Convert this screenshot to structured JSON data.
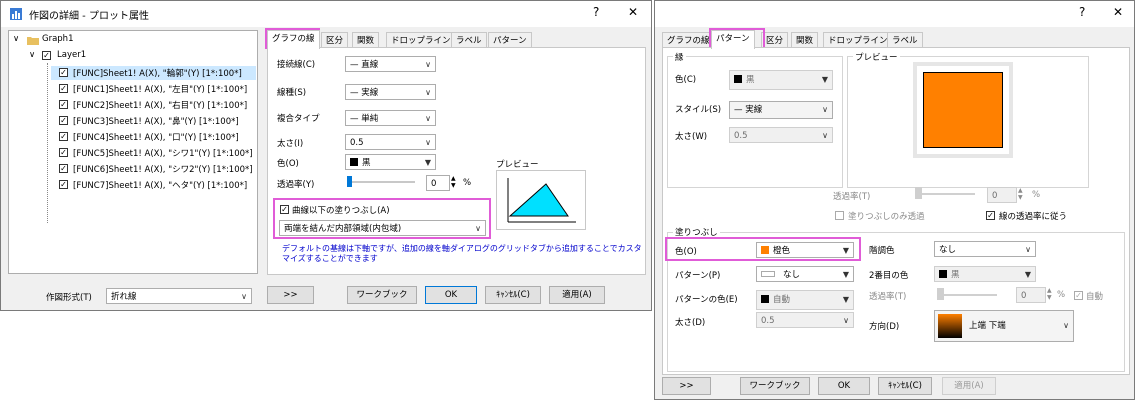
{
  "left_dialog": {
    "title": "作図の詳細 - プロット属性",
    "help_label": "?",
    "close_label": "✕",
    "tree": {
      "graph": "Graph1",
      "layer": "Layer1",
      "items": [
        "[FUNC]Sheet1! A(X), \"輪郭\"(Y) [1*:100*]",
        "[FUNC1]Sheet1! A(X), \"左目\"(Y) [1*:100*]",
        "[FUNC2]Sheet1! A(X), \"右目\"(Y) [1*:100*]",
        "[FUNC3]Sheet1! A(X), \"鼻\"(Y) [1*:100*]",
        "[FUNC4]Sheet1! A(X), \"口\"(Y) [1*:100*]",
        "[FUNC5]Sheet1! A(X), \"シワ1\"(Y) [1*:100*]",
        "[FUNC6]Sheet1! A(X), \"シワ2\"(Y) [1*:100*]",
        "[FUNC7]Sheet1! A(X), \"ヘタ\"(Y) [1*:100*]"
      ]
    },
    "tabs": [
      "グラフの線",
      "区分",
      "関数",
      "ドロップライン",
      "ラベル",
      "パターン"
    ],
    "fields": {
      "connect_label": "接続線(C)",
      "connect_value": "— 直線",
      "linetype_label": "線種(S)",
      "linetype_value": "— 実線",
      "compound_label": "複合タイプ",
      "compound_value": "— 単純",
      "width_label": "太さ(I)",
      "width_value": "0.5",
      "color_label": "色(O)",
      "color_value": "黒",
      "color_hex": "#000000",
      "transparency_label": "透過率(Y)",
      "transparency_value": "0",
      "transparency_unit": "%",
      "preview_label": "プレビュー"
    },
    "fill": {
      "checkbox_label": "曲線以下の塗りつぶし(A)",
      "checked": true,
      "mode_value": "両端を結んだ内部領域(内包域)"
    },
    "note": "デフォルトの基線は下軸ですが、追加の線を軸ダイアログのグリッドタブから追加することでカスタマイズすることができます",
    "footer": {
      "plot_type_label": "作図形式(T)",
      "plot_type_value": "折れ線",
      "more_label": ">>",
      "workbook_label": "ワークブック",
      "ok_label": "OK",
      "cancel_label": "ｷｬﾝｾﾙ(C)",
      "apply_label": "適用(A)"
    }
  },
  "right_dialog": {
    "help_label": "?",
    "close_label": "✕",
    "tabs": [
      "グラフの線",
      "パターン",
      "区分",
      "関数",
      "ドロップライン",
      "ラベル"
    ],
    "border": {
      "group_label": "縁",
      "color_label": "色(C)",
      "color_value": "黒",
      "color_hex": "#000000",
      "style_label": "スタイル(S)",
      "style_value": "— 実線",
      "width_label": "太さ(W)",
      "width_value": "0.5"
    },
    "preview": {
      "group_label": "プレビュー",
      "fill_hex": "#ff8000",
      "transparency_label": "透過率(T)",
      "transparency_value": "0",
      "transparency_unit": "%",
      "fill_only_label": "塗りつぶしのみ透過",
      "fill_only_checked": false,
      "follow_label": "線の透過率に従う",
      "follow_checked": true
    },
    "fill": {
      "group_label": "塗りつぶし",
      "color_label": "色(O)",
      "color_value": "橙色",
      "color_hex": "#ff8000",
      "gradient_label": "階調色",
      "gradient_value": "なし",
      "pattern_label": "パターン(P)",
      "pattern_value": "なし",
      "second_color_label": "2番目の色",
      "second_color_value": "黒",
      "second_color_hex": "#000000",
      "pattern_color_label": "パターンの色(E)",
      "pattern_color_value": "自動",
      "transparency_label": "透過率(T)",
      "transparency_value": "0",
      "transparency_unit": "%",
      "auto_label": "自動",
      "auto_checked": true,
      "width_label": "太さ(D)",
      "width_value": "0.5",
      "direction_label": "方向(D)",
      "direction_value": "上端 下端"
    },
    "footer": {
      "more_label": ">>",
      "workbook_label": "ワークブック",
      "ok_label": "OK",
      "cancel_label": "ｷｬﾝｾﾙ(C)",
      "apply_label": "適用(A)"
    }
  }
}
